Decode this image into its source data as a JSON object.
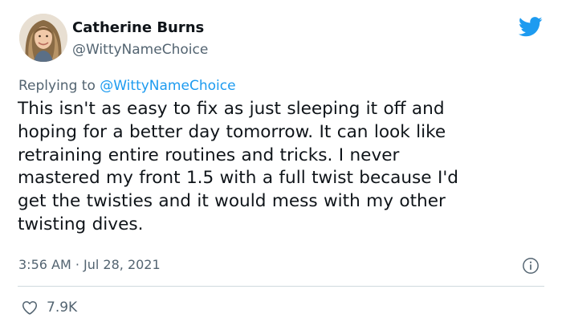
{
  "author": {
    "display_name": "Catherine Burns",
    "handle": "@WittyNameChoice"
  },
  "reply": {
    "prefix": "Replying to ",
    "mention": "@WittyNameChoice"
  },
  "tweet": {
    "lines": [
      "This isn't as easy to fix as just sleeping it off and",
      "hoping for a better day tomorrow. It can look like",
      "retraining entire routines and tricks. I never",
      "mastered my front 1.5 with a full twist because I'd",
      "get the twisties and it would mess with my other",
      "twisting dives."
    ],
    "timestamp": "3:56 AM · Jul 28, 2021"
  },
  "engagement": {
    "like_count": "7.9K"
  },
  "icons": {
    "brand": "twitter-bird-icon",
    "info": "info-icon",
    "like": "heart-icon"
  },
  "colors": {
    "brand": "#1d9bf0",
    "text": "#0f1419",
    "secondary": "#536471",
    "divider": "#cfd9de"
  }
}
